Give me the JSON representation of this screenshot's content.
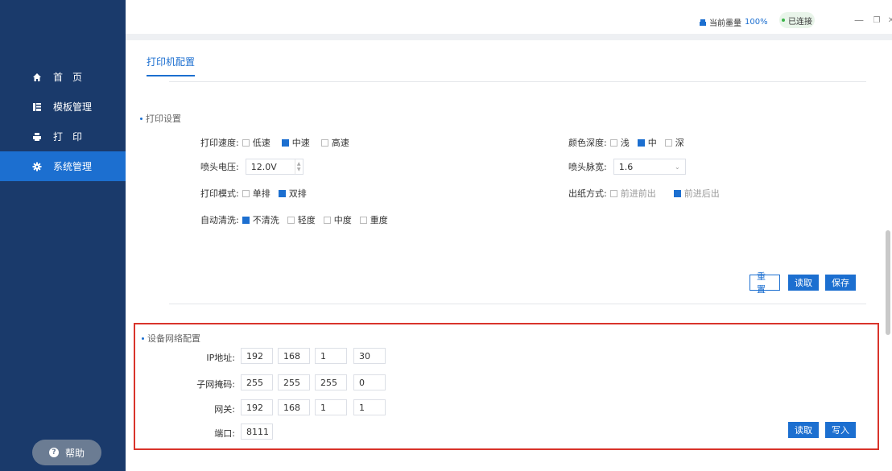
{
  "sidebar": {
    "items": [
      {
        "label": "首　页",
        "icon": "home-icon"
      },
      {
        "label": "模板管理",
        "icon": "template-icon"
      },
      {
        "label": "打　印",
        "icon": "printer-icon"
      },
      {
        "label": "系统管理",
        "icon": "gear-icon"
      }
    ],
    "active_index": 3,
    "help_label": "帮助"
  },
  "titlebar": {
    "ink_label": "当前墨量",
    "ink_value": "100%",
    "connection_label": "已连接",
    "minimize": "—",
    "restore": "❐",
    "close": "✕"
  },
  "tabs": [
    "打印机配置"
  ],
  "print_settings": {
    "title": "打印设置",
    "speed": {
      "label": "打印速度:",
      "options": [
        "低速",
        "中速",
        "高速"
      ],
      "selected": 1
    },
    "color_depth": {
      "label": "颜色深度:",
      "options": [
        "浅",
        "中",
        "深"
      ],
      "selected": 1
    },
    "voltage": {
      "label": "喷头电压:",
      "value": "12.0V"
    },
    "pulse": {
      "label": "喷头脉宽:",
      "value": "1.6"
    },
    "mode": {
      "label": "打印模式:",
      "options": [
        "单排",
        "双排"
      ],
      "selected": 1
    },
    "paper_out": {
      "label": "出纸方式:",
      "options": [
        "前进前出",
        "前进后出"
      ],
      "selected": 1
    },
    "clean": {
      "label": "自动清洗:",
      "options": [
        "不清洗",
        "轻度",
        "中度",
        "重度"
      ],
      "selected": 0
    },
    "buttons": {
      "reset": "重置",
      "read": "读取",
      "save": "保存"
    }
  },
  "network": {
    "title": "设备网络配置",
    "ip": {
      "label": "IP地址:",
      "values": [
        "192",
        "168",
        "1",
        "30"
      ]
    },
    "mask": {
      "label": "子网掩码:",
      "values": [
        "255",
        "255",
        "255",
        "0"
      ]
    },
    "gateway": {
      "label": "网关:",
      "values": [
        "192",
        "168",
        "1",
        "1"
      ]
    },
    "port": {
      "label": "端口:",
      "value": "8111"
    },
    "buttons": {
      "read": "读取",
      "write": "写入"
    }
  },
  "colors": {
    "accent": "#1c6fd0",
    "sidebar": "#1a3a6b",
    "highlight": "#d9342b"
  }
}
